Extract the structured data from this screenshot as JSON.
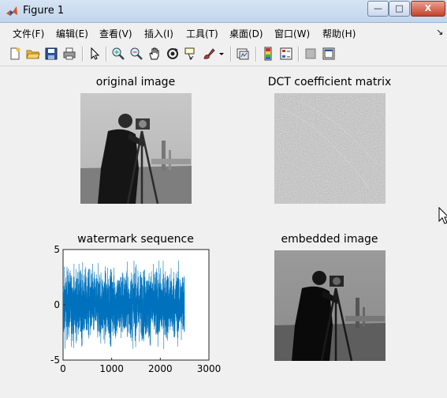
{
  "window": {
    "title": "Figure 1",
    "controls": [
      "—",
      "□",
      "X"
    ]
  },
  "menubar": {
    "items": [
      "文件(F)",
      "编辑(E)",
      "查看(V)",
      "插入(I)",
      "工具(T)",
      "桌面(D)",
      "窗口(W)",
      "帮助(H)"
    ],
    "overflow_arrow": "↘"
  },
  "toolbar": {
    "icons": [
      "new-figure-icon",
      "open-file-icon",
      "save-icon",
      "print-icon",
      "pointer-icon",
      "zoom-in-icon",
      "zoom-out-icon",
      "pan-icon",
      "rotate-3d-icon",
      "data-cursor-icon",
      "brush-icon",
      "dropdown-icon",
      "link-plot-icon",
      "colorbar-icon",
      "legend-icon",
      "hide-plot-tools-icon",
      "show-plot-tools-icon"
    ]
  },
  "figure": {
    "panels": {
      "original": {
        "title": "original image"
      },
      "dct": {
        "title": "DCT coefficient matrix"
      },
      "watermark": {
        "title": "watermark sequence"
      },
      "embedded": {
        "title": "embedded image"
      }
    }
  },
  "chart_data": {
    "type": "line",
    "title": "watermark sequence",
    "xlabel": "",
    "ylabel": "",
    "xlim": [
      0,
      3000
    ],
    "ylim": [
      -5,
      5
    ],
    "xticks": [
      "0",
      "1000",
      "2000",
      "3000"
    ],
    "yticks": [
      "5",
      "0",
      "-5"
    ],
    "series": [
      {
        "n_points": 2500,
        "approx_range": [
          -4,
          4
        ],
        "color": "#0072bd"
      }
    ]
  }
}
